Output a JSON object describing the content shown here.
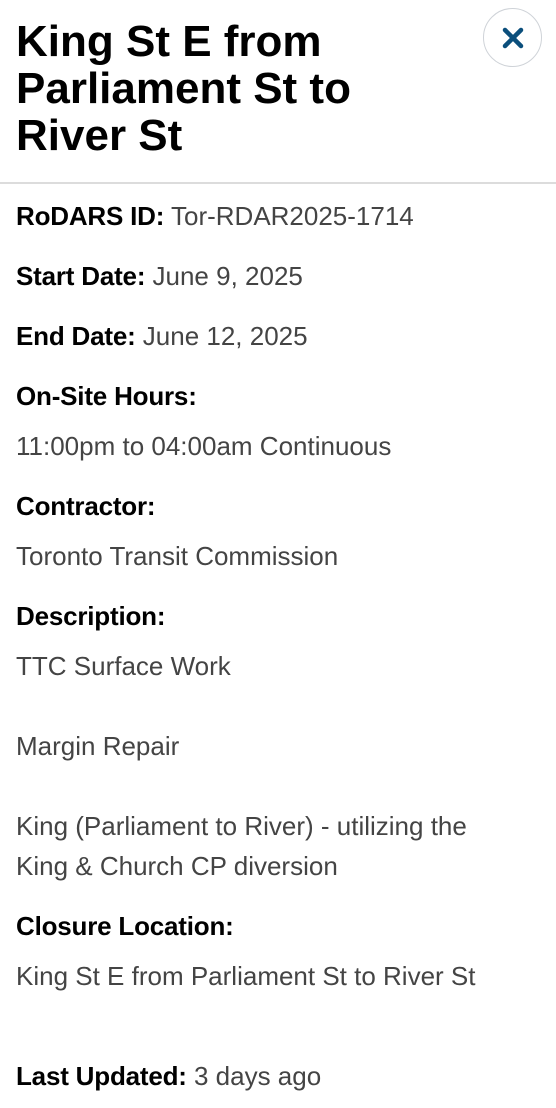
{
  "header": {
    "title": "King St E from Parliament St to River St",
    "close_icon": "close-icon",
    "accent_color": "#0b4f7c"
  },
  "details": {
    "rodars_id_label": "RoDARS ID:",
    "rodars_id_value": "Tor-RDAR2025-1714",
    "start_date_label": "Start Date:",
    "start_date_value": "June 9, 2025",
    "end_date_label": "End Date:",
    "end_date_value": "June 12, 2025",
    "onsite_hours_label": "On-Site Hours:",
    "onsite_hours_value": "11:00pm to 04:00am Continuous",
    "contractor_label": "Contractor:",
    "contractor_value": "Toronto Transit Commission",
    "description_label": "Description:",
    "description_lines": [
      "TTC Surface Work",
      "Margin Repair",
      "King (Parliament to River) - utilizing the King & Church CP diversion"
    ],
    "closure_location_label": "Closure Location:",
    "closure_location_value": "King St E from Parliament St to River St",
    "last_updated_label": "Last Updated:",
    "last_updated_value": "3 days ago"
  }
}
